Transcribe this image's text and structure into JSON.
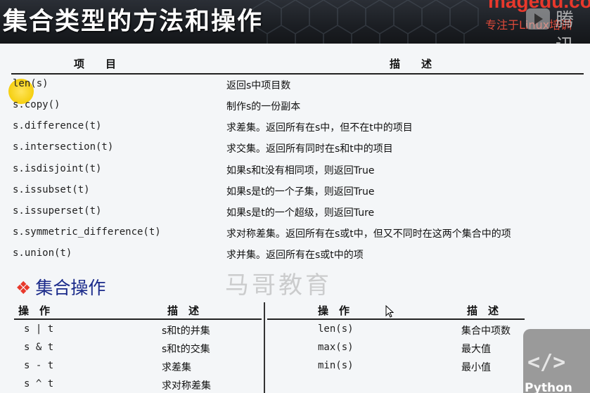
{
  "banner": {
    "title": "集合类型的方法和操作",
    "brand": "magedu.com",
    "slogan": "专注于Linux培训",
    "watermark_char": "腾讯"
  },
  "table": {
    "headers": {
      "item": "项　　目",
      "desc": "描　　述"
    },
    "rows": [
      {
        "method": "len(s)",
        "desc": "返回s中项目数"
      },
      {
        "method": "s.copy()",
        "desc": "制作s的一份副本"
      },
      {
        "method": "s.difference(t)",
        "desc": "求差集。返回所有在s中，但不在t中的项目"
      },
      {
        "method": "s.intersection(t)",
        "desc": "求交集。返回所有同时在s和t中的项目"
      },
      {
        "method": "s.isdisjoint(t)",
        "desc": "如果s和t没有相同项，则返回True"
      },
      {
        "method": "s.issubset(t)",
        "desc": "如果s是t的一个子集，则返回True"
      },
      {
        "method": "s.issuperset(t)",
        "desc": "如果s是t的一个超级，则返回Ture"
      },
      {
        "method": "s.symmetric_difference(t)",
        "desc": "求对称差集。返回所有在s或t中，但又不同时在这两个集合中的项"
      },
      {
        "method": "s.union(t)",
        "desc": "求并集。返回所有在s或t中的项"
      }
    ]
  },
  "ops": {
    "title": "集合操作",
    "watermark": "马哥教育",
    "left_headers": {
      "op": "操　作",
      "desc": "描　述"
    },
    "right_headers": {
      "op": "操　作",
      "desc": "描　述"
    },
    "left_rows": [
      {
        "op": "s | t",
        "desc": "s和t的并集"
      },
      {
        "op": "s & t",
        "desc": "s和t的交集"
      },
      {
        "op": "s - t",
        "desc": "求差集"
      },
      {
        "op": "s ^ t",
        "desc": "求对称差集"
      }
    ],
    "right_rows": [
      {
        "op": "len(s)",
        "desc": "集合中项数"
      },
      {
        "op": "max(s)",
        "desc": "最大值"
      },
      {
        "op": "min(s)",
        "desc": "最小值"
      }
    ]
  },
  "badge": {
    "code": "</>",
    "word": "Python"
  },
  "colors": {
    "banner_bg": "#1b1e23",
    "title_text": "#ffffff",
    "brand_red": "#e8382c",
    "section_blue": "#1a2a8a",
    "highlight_yellow": "#f5cf10"
  }
}
